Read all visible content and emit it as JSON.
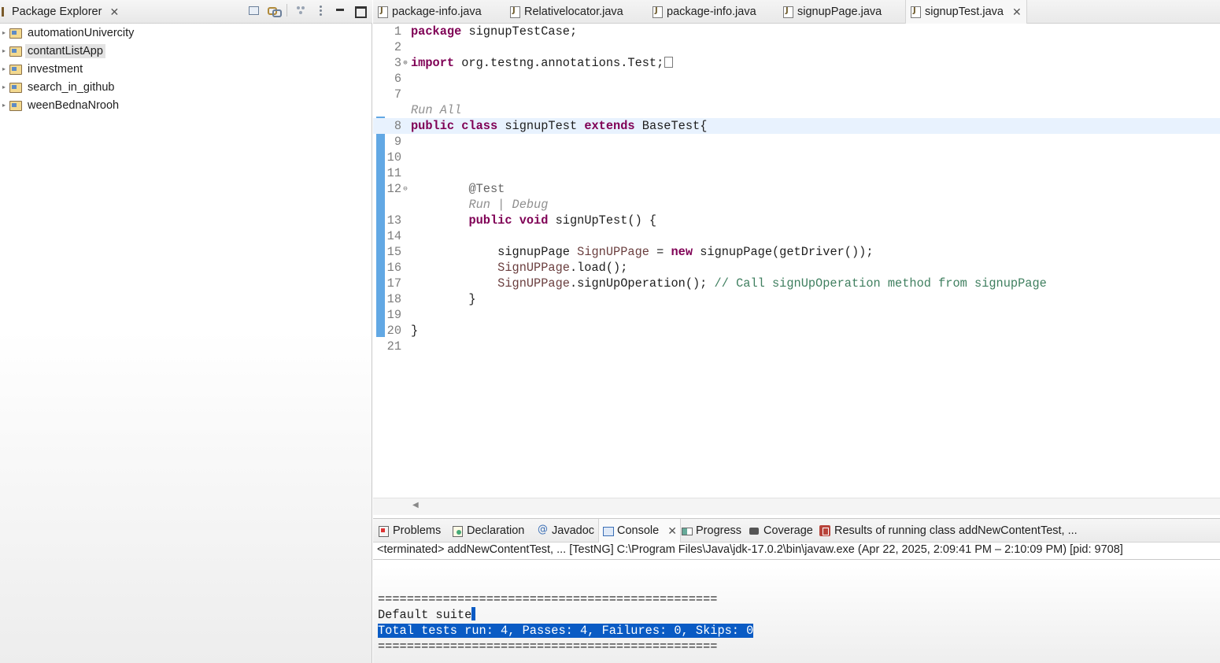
{
  "explorer": {
    "title": "Package Explorer",
    "projects": [
      {
        "label": "automationUnivercity",
        "selected": false
      },
      {
        "label": "contantListApp",
        "selected": true
      },
      {
        "label": "investment",
        "selected": false
      },
      {
        "label": "search_in_github",
        "selected": false
      },
      {
        "label": "weenBednaNrooh",
        "selected": false
      }
    ]
  },
  "editor": {
    "tabs": [
      {
        "label": "package-info.java"
      },
      {
        "label": "Relativelocator.java"
      },
      {
        "label": "package-info.java"
      },
      {
        "label": "signupPage.java"
      },
      {
        "label": "signupTest.java",
        "active": true
      }
    ],
    "lens": {
      "run_all": "Run All",
      "run_debug": "Run | Debug"
    },
    "lines": [
      {
        "num": "1",
        "parts": [
          [
            "kw",
            "package"
          ],
          [
            "t",
            " signupTestCase;"
          ]
        ]
      },
      {
        "num": "2",
        "parts": []
      },
      {
        "num": "3",
        "fold": "plus",
        "parts": [
          [
            "kw",
            "import"
          ],
          [
            "t",
            " org.testng.annotations.Test;"
          ]
        ],
        "folded": true
      },
      {
        "num": "6",
        "parts": []
      },
      {
        "num": "7",
        "parts": []
      },
      {
        "lens": "run_all"
      },
      {
        "num": "8",
        "current": true,
        "parts": [
          [
            "kw",
            "public"
          ],
          [
            "t",
            " "
          ],
          [
            "kw",
            "class"
          ],
          [
            "t",
            " signupTest "
          ],
          [
            "kw",
            "extends"
          ],
          [
            "t",
            " BaseTest{"
          ]
        ]
      },
      {
        "num": "9",
        "parts": []
      },
      {
        "num": "10",
        "parts": []
      },
      {
        "num": "11",
        "parts": []
      },
      {
        "num": "12",
        "fold": "minus",
        "parts": [
          [
            "t",
            "        "
          ],
          [
            "ann",
            "@Test"
          ]
        ]
      },
      {
        "lens": "run_debug",
        "indent": "        "
      },
      {
        "num": "13",
        "parts": [
          [
            "t",
            "        "
          ],
          [
            "kw",
            "public"
          ],
          [
            "t",
            " "
          ],
          [
            "kw",
            "void"
          ],
          [
            "t",
            " signUpTest() {"
          ]
        ]
      },
      {
        "num": "14",
        "parts": []
      },
      {
        "num": "15",
        "parts": [
          [
            "t",
            "            signupPage "
          ],
          [
            "iv",
            "SignUPPage"
          ],
          [
            "t",
            " = "
          ],
          [
            "kw",
            "new"
          ],
          [
            "t",
            " signupPage(getDriver());"
          ]
        ]
      },
      {
        "num": "16",
        "parts": [
          [
            "t",
            "            "
          ],
          [
            "iv",
            "SignUPPage"
          ],
          [
            "t",
            ".load();"
          ]
        ]
      },
      {
        "num": "17",
        "parts": [
          [
            "t",
            "            "
          ],
          [
            "iv",
            "SignUPPage"
          ],
          [
            "t",
            ".signUpOperation(); "
          ],
          [
            "cm",
            "// Call signUpOperation method from signupPage"
          ]
        ]
      },
      {
        "num": "18",
        "parts": [
          [
            "t",
            "        }"
          ]
        ]
      },
      {
        "num": "19",
        "parts": []
      },
      {
        "num": "20",
        "parts": [
          [
            "t",
            "}"
          ]
        ]
      },
      {
        "num": "21",
        "parts": []
      }
    ],
    "colors": {
      "keyword": "#7f0055",
      "comment": "#3f7f5f",
      "current_line": "#e8f2fe",
      "change_bar": "#62a8e4"
    }
  },
  "bottom": {
    "tabs": [
      {
        "label": "Problems",
        "icon": "problems-icon"
      },
      {
        "label": "Declaration",
        "icon": "declaration-icon"
      },
      {
        "label": "Javadoc",
        "icon": "javadoc-icon"
      },
      {
        "label": "Console",
        "icon": "console-icon",
        "active": true
      },
      {
        "label": "Progress",
        "icon": "progress-icon"
      },
      {
        "label": "Coverage",
        "icon": "coverage-icon"
      },
      {
        "label": "Results of running class addNewContentTest, ...",
        "icon": "testng-results-icon"
      }
    ],
    "status": "<terminated> addNewContentTest, ... [TestNG] C:\\Program Files\\Java\\jdk-17.0.2\\bin\\javaw.exe  (Apr 22, 2025, 2:09:41 PM – 2:10:09 PM) [pid: 9708]",
    "output": {
      "rule": "===============================================",
      "suite": "Default suite",
      "summary": "Total tests run: 4, Passes: 4, Failures: 0, Skips: 0"
    },
    "selection_color": "#0a5bc4"
  }
}
